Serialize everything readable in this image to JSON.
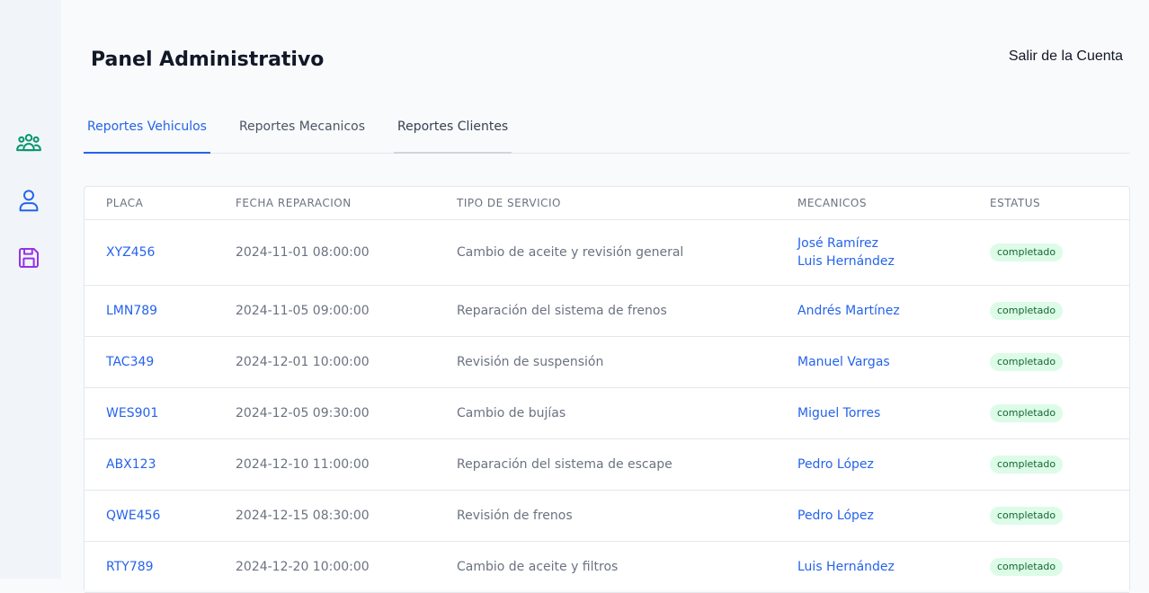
{
  "sidebar": {
    "icons": [
      {
        "name": "users-group-icon",
        "color": "#059669"
      },
      {
        "name": "user-icon",
        "color": "#2563eb"
      },
      {
        "name": "save-icon",
        "color": "#9333ea"
      }
    ]
  },
  "header": {
    "title": "Panel Administrativo",
    "logout_label": "Salir de la Cuenta"
  },
  "tabs": [
    {
      "label": "Reportes Vehiculos",
      "active": true
    },
    {
      "label": "Reportes Mecanicos",
      "active": false
    },
    {
      "label": "Reportes Clientes",
      "active": false
    }
  ],
  "table": {
    "columns": [
      "PLACA",
      "FECHA REPARACION",
      "TIPO DE SERVICIO",
      "MECANICOS",
      "ESTATUS"
    ],
    "rows": [
      {
        "placa": "XYZ456",
        "fecha": "2024-11-01 08:00:00",
        "tipo": "Cambio de aceite y revisión general",
        "mecanicos": [
          "José Ramírez",
          "Luis Hernández"
        ],
        "estatus": "completado"
      },
      {
        "placa": "LMN789",
        "fecha": "2024-11-05 09:00:00",
        "tipo": "Reparación del sistema de frenos",
        "mecanicos": [
          "Andrés Martínez"
        ],
        "estatus": "completado"
      },
      {
        "placa": "TAC349",
        "fecha": "2024-12-01 10:00:00",
        "tipo": "Revisión de suspensión",
        "mecanicos": [
          "Manuel Vargas"
        ],
        "estatus": "completado"
      },
      {
        "placa": "WES901",
        "fecha": "2024-12-05 09:30:00",
        "tipo": "Cambio de bujías",
        "mecanicos": [
          "Miguel Torres"
        ],
        "estatus": "completado"
      },
      {
        "placa": "ABX123",
        "fecha": "2024-12-10 11:00:00",
        "tipo": "Reparación del sistema de escape",
        "mecanicos": [
          "Pedro López"
        ],
        "estatus": "completado"
      },
      {
        "placa": "QWE456",
        "fecha": "2024-12-15 08:30:00",
        "tipo": "Revisión de frenos",
        "mecanicos": [
          "Pedro López"
        ],
        "estatus": "completado"
      },
      {
        "placa": "RTY789",
        "fecha": "2024-12-20 10:00:00",
        "tipo": "Cambio de aceite y filtros",
        "mecanicos": [
          "Luis Hernández"
        ],
        "estatus": "completado"
      }
    ]
  }
}
